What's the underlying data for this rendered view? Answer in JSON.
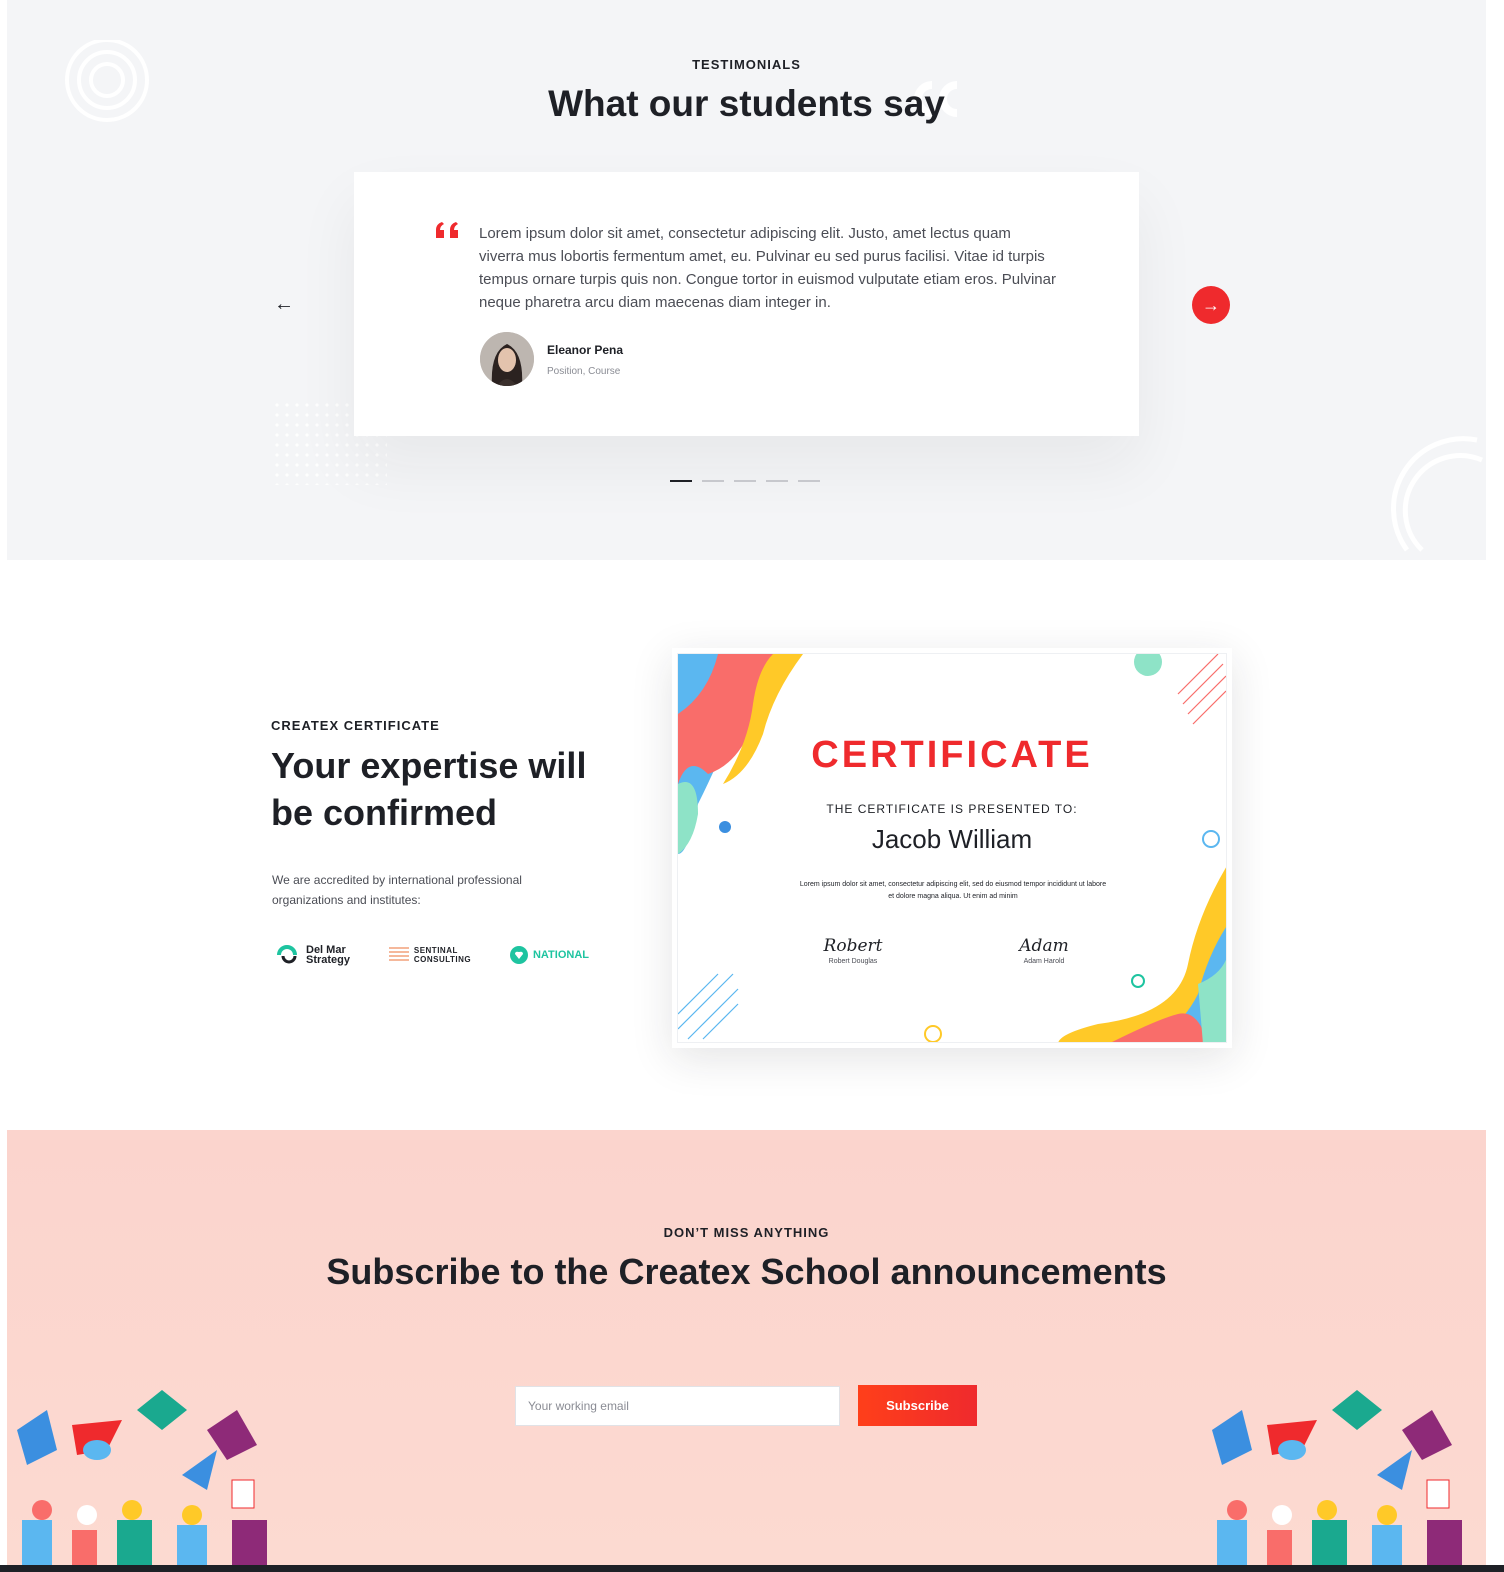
{
  "testimonials": {
    "eyebrow": "TESTIMONIALS",
    "title": "What our students say",
    "quote": "Lorem ipsum dolor sit amet, consectetur adipiscing elit. Justo, amet lectus quam viverra mus lobortis fermentum amet, eu. Pulvinar eu sed purus facilisi. Vitae id turpis tempus ornare turpis quis non. Congue tortor in euismod vulputate etiam eros. Pulvinar neque pharetra arcu diam maecenas diam integer in.",
    "author_name": "Eleanor Pena",
    "author_role": "Position, Course",
    "prev_icon": "arrow-left-icon",
    "next_icon": "arrow-right-icon",
    "pagination_count": 5,
    "pagination_active": 1
  },
  "certificate_section": {
    "eyebrow": "CREATEX CERTIFICATE",
    "title": "Your expertise will be confirmed",
    "description": "We are accredited by international professional organizations and institutes:",
    "logos": [
      {
        "name": "Del Mar Strategy",
        "line1": "Del Mar",
        "line2": "Strategy"
      },
      {
        "name": "Sentinal Consulting",
        "line1": "SENTINAL",
        "line2": "CONSULTING"
      },
      {
        "name": "National",
        "line1": "NATIONAL"
      }
    ],
    "certificate": {
      "title": "CERTIFICATE",
      "presented": "THE CERTIFICATE IS PRESENTED TO:",
      "recipient": "Jacob William",
      "body": "Lorem ipsum dolor sit amet, consectetur adipiscing elit, sed do eiusmod tempor incididunt ut labore et dolore magna aliqua. Ut enim ad minim",
      "signature_left": {
        "script": "Robert",
        "name": "Robert Douglas"
      },
      "signature_right": {
        "script": "Adam",
        "name": "Adam Harold"
      }
    }
  },
  "subscribe": {
    "eyebrow": "DON’T MISS ANYTHING",
    "title": "Subscribe to the Createx School announcements",
    "input_placeholder": "Your working email",
    "button_label": "Subscribe"
  },
  "colors": {
    "accent": "#ef2a2d",
    "dark": "#1e2026",
    "teal": "#1ec4a0",
    "testimonial_bg": "#f4f5f7",
    "subscribe_bg": "#fcd8cf"
  }
}
